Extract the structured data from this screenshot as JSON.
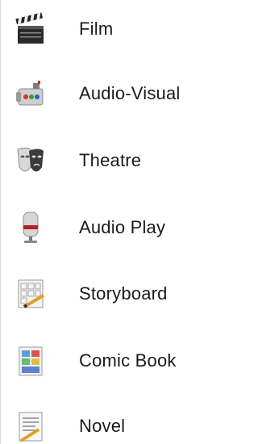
{
  "list": {
    "items": [
      {
        "label": "Film",
        "icon": "film-clapperboard-icon"
      },
      {
        "label": "Audio-Visual",
        "icon": "audio-visual-camera-icon"
      },
      {
        "label": "Theatre",
        "icon": "theatre-masks-icon"
      },
      {
        "label": "Audio Play",
        "icon": "microphone-icon"
      },
      {
        "label": "Storyboard",
        "icon": "storyboard-icon"
      },
      {
        "label": "Comic Book",
        "icon": "comic-book-icon"
      },
      {
        "label": "Novel",
        "icon": "novel-icon"
      }
    ]
  }
}
